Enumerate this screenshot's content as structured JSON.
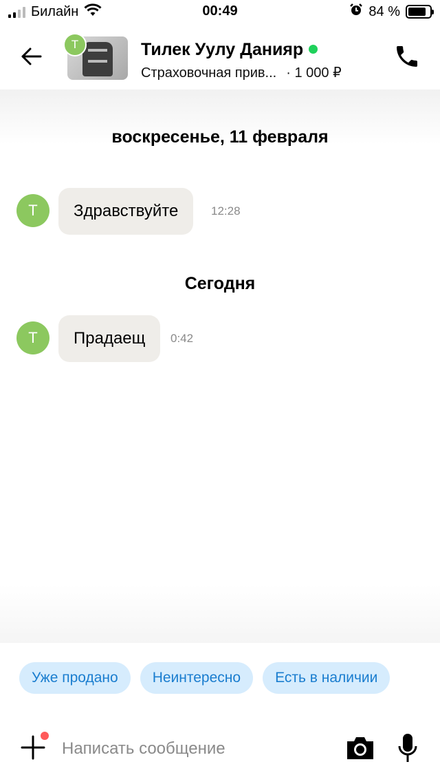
{
  "status_bar": {
    "carrier": "Билайн",
    "time": "00:49",
    "battery_percent": "84 %",
    "battery_level": 0.84
  },
  "header": {
    "contact_name": "Тилек Уулу Данияр",
    "avatar_letter": "Т",
    "listing_title": "Страховочная прив...",
    "listing_price": "· 1 000 ₽",
    "online_color": "#1fd15b"
  },
  "chat": {
    "groups": [
      {
        "date": "воскресенье, 11 февраля",
        "messages": [
          {
            "avatar_letter": "Т",
            "text": "Здравствуйте",
            "time": "12:28"
          }
        ]
      },
      {
        "date": "Сегодня",
        "messages": [
          {
            "avatar_letter": "Т",
            "text": "Прадаещ",
            "time": "0:42"
          }
        ]
      }
    ]
  },
  "quick_replies": [
    "Уже продано",
    "Неинтересно",
    "Есть в наличии"
  ],
  "composer": {
    "placeholder": "Написать сообщение"
  },
  "colors": {
    "accent": "#1a7dcf",
    "chip_bg": "#d6ecfd",
    "avatar_bg": "#8cc85f",
    "bubble_bg": "#efede9"
  }
}
